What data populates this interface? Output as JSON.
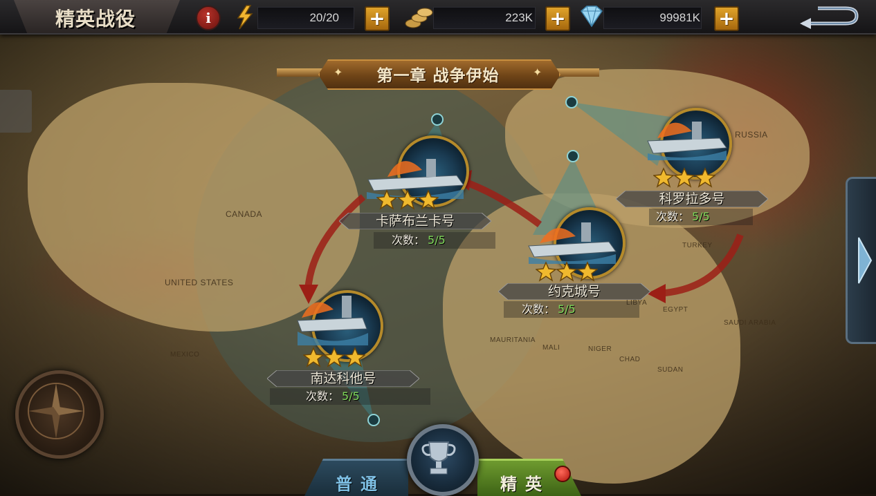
{
  "topbar": {
    "title": "精英战役",
    "energy": "20/20",
    "coins": "223K",
    "diamonds": "99981K"
  },
  "chapter": {
    "title": "第一章  战争伊始"
  },
  "map_labels": {
    "canada": "CANADA",
    "united_states": "UNITED STATES",
    "russia": "RUSSIA",
    "turkey": "TURKEY",
    "libya": "LIBYA",
    "egypt": "EGYPT",
    "saudi_arabia": "SAUDI ARABIA",
    "sudan": "SUDAN",
    "chad": "CHAD",
    "niger": "NIGER",
    "mali": "MALI",
    "mauritania": "MAURITANIA",
    "mexico": "MEXICO"
  },
  "ships": [
    {
      "name": "卡萨布兰卡号",
      "attempts_label": "次数：",
      "attempts": "5/5",
      "stars": 3
    },
    {
      "name": "科罗拉多号",
      "attempts_label": "次数：",
      "attempts": "5/5",
      "stars": 3
    },
    {
      "name": "约克城号",
      "attempts_label": "次数：",
      "attempts": "5/5",
      "stars": 3
    },
    {
      "name": "南达科他号",
      "attempts_label": "次数：",
      "attempts": "5/5",
      "stars": 3
    }
  ],
  "bottom_tabs": {
    "normal": "普通",
    "elite": "精英"
  },
  "colors": {
    "accent_gold": "#e0a32a",
    "attempt_green": "#7fd85a",
    "route_red": "#9c1f16",
    "radar_teal": "#3a8f96"
  },
  "icons": {
    "info": "info-icon",
    "energy": "lightning-icon",
    "coins": "coins-icon",
    "diamond": "diamond-icon",
    "back": "back-arrow-icon",
    "trophy": "trophy-icon",
    "compass": "compass-icon"
  }
}
